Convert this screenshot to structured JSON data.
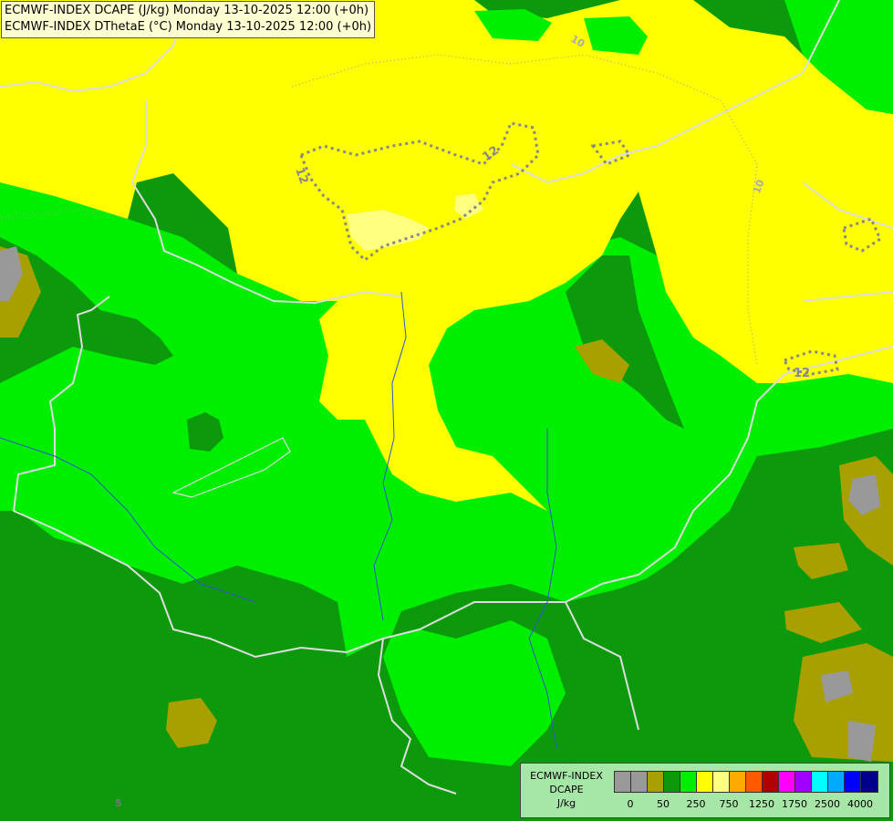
{
  "header": {
    "line1": "ECMWF-INDEX DCAPE (J/kg) Monday 13-10-2025 12:00 (+0h)",
    "line2": "ECMWF-INDEX DThetaE (°C) Monday 13-10-2025 12:00 (+0h)"
  },
  "legend": {
    "line1": "ECMWF-INDEX",
    "line2": "DCAPE",
    "line3": "J/kg",
    "colors": [
      "#999999",
      "#999999",
      "#a8a000",
      "#0c9a0c",
      "#00ee00",
      "#ffff00",
      "#ffff80",
      "#ffaa00",
      "#ff5a00",
      "#b00000",
      "#ff00ff",
      "#a000ff",
      "#00ffff",
      "#00aaff",
      "#0000ff",
      "#00008c"
    ],
    "ticks": [
      "0",
      "50",
      "250",
      "750",
      "1250",
      "1750",
      "2500",
      "4000"
    ]
  },
  "contours": {
    "labels": [
      "12",
      "12",
      "12",
      "10",
      "10",
      "5"
    ]
  },
  "map_colors": {
    "dark_green": "#0c9a0c",
    "bright_green": "#00ee00",
    "yellow": "#ffff00",
    "light_yellow": "#ffff80",
    "olive": "#a8a000",
    "gray": "#999999",
    "border": "#dddddd",
    "river": "#3355cc"
  }
}
